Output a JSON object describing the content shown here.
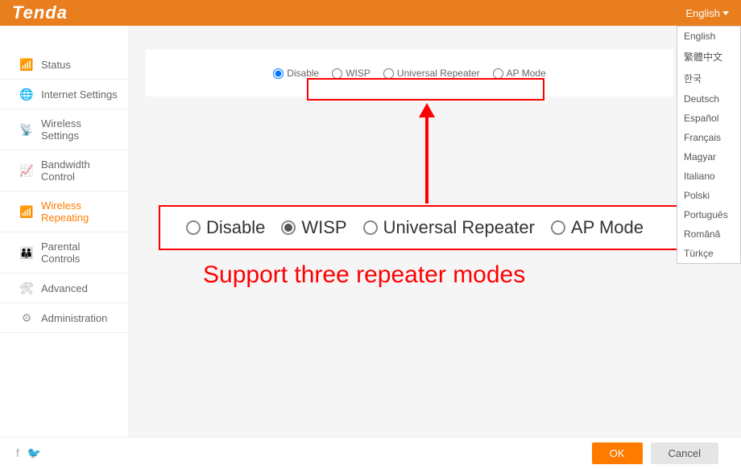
{
  "header": {
    "brand": "Tenda",
    "language_label": "English"
  },
  "languages": [
    "English",
    "繁體中文",
    "한국",
    "Deutsch",
    "Español",
    "Français",
    "Magyar",
    "Italiano",
    "Polski",
    "Português",
    "Română",
    "Türkçe"
  ],
  "sidebar": {
    "items": [
      {
        "label": "Status",
        "icon": "📶"
      },
      {
        "label": "Internet Settings",
        "icon": "🌐"
      },
      {
        "label": "Wireless Settings",
        "icon": "📡"
      },
      {
        "label": "Bandwidth Control",
        "icon": "📈"
      },
      {
        "label": "Wireless Repeating",
        "icon": "📶"
      },
      {
        "label": "Parental Controls",
        "icon": "👪"
      },
      {
        "label": "Advanced",
        "icon": "🛠"
      },
      {
        "label": "Administration",
        "icon": "⚙"
      }
    ],
    "active_index": 4
  },
  "modes": {
    "options": [
      "Disable",
      "WISP",
      "Universal Repeater",
      "AP Mode"
    ],
    "selected_small": "Disable",
    "selected_big": "WISP"
  },
  "annotation": {
    "caption": "Support three repeater modes"
  },
  "footer": {
    "ok": "OK",
    "cancel": "Cancel"
  }
}
